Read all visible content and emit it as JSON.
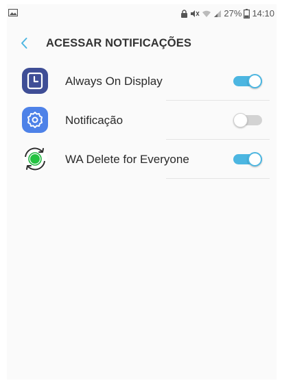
{
  "status_bar": {
    "battery_text": "27%",
    "time": "14:10"
  },
  "header": {
    "title": "ACESSAR NOTIFICAÇÕES"
  },
  "apps": [
    {
      "label": "Always On Display",
      "enabled": true,
      "icon": "clock-icon"
    },
    {
      "label": "Notificação",
      "enabled": false,
      "icon": "gear-icon"
    },
    {
      "label": "WA Delete for Everyone",
      "enabled": true,
      "icon": "whatsapp-refresh-icon"
    }
  ],
  "colors": {
    "accent": "#4cb6e1",
    "toggle_off": "#d3d3d3"
  }
}
